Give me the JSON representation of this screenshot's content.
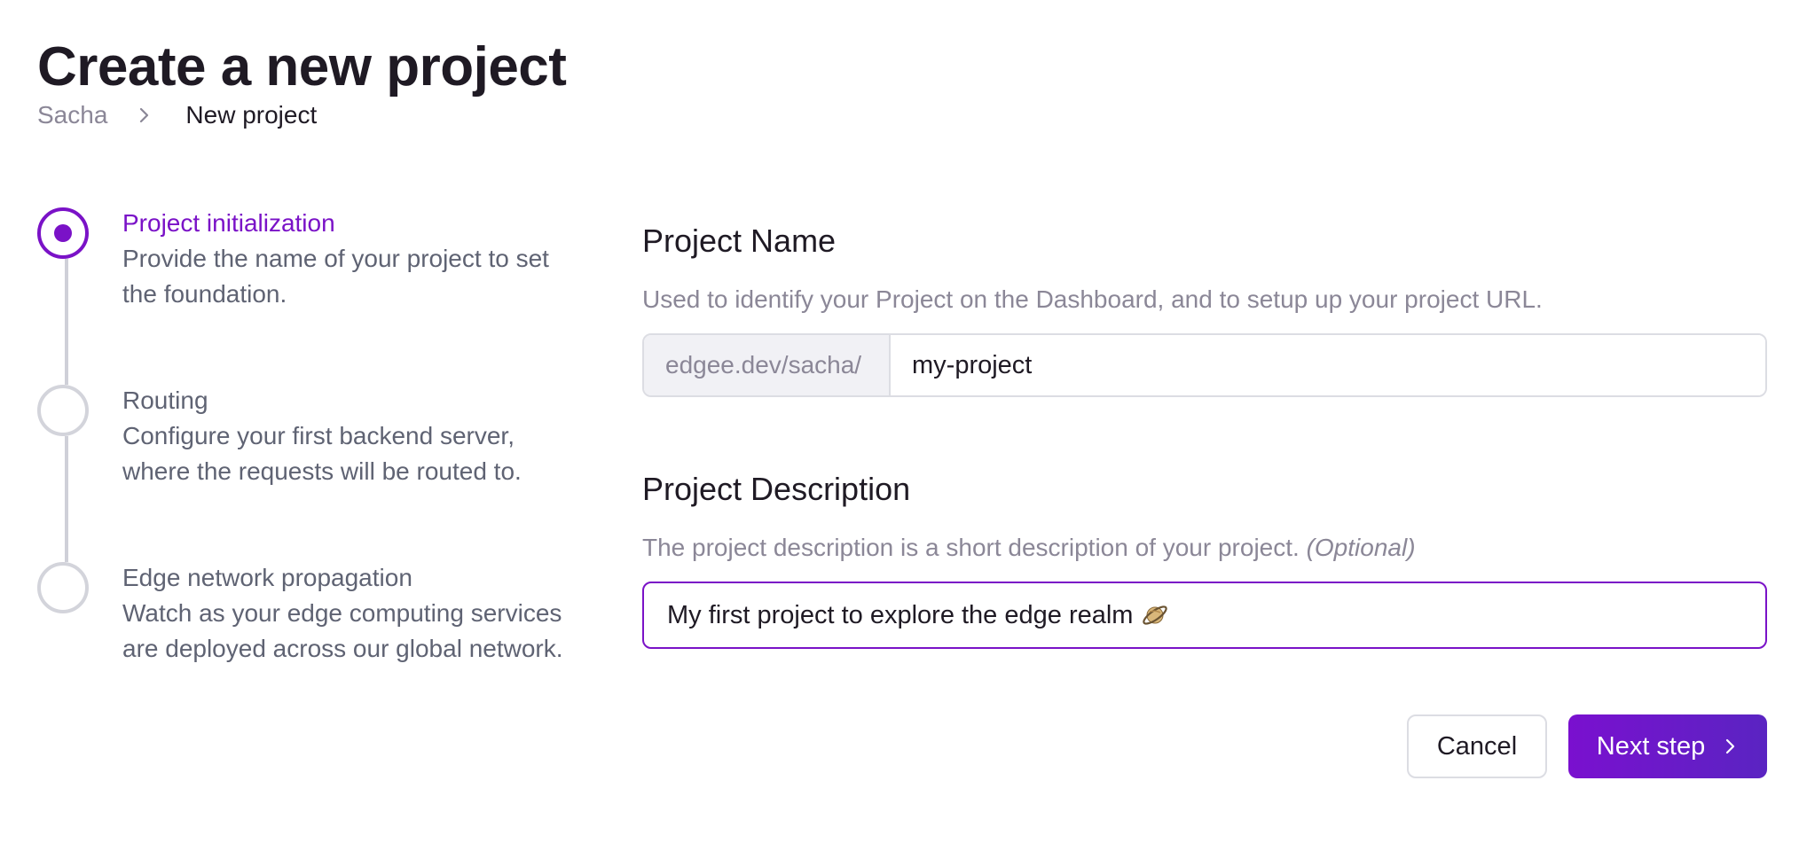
{
  "header": {
    "title": "Create a new project",
    "breadcrumb": {
      "root": "Sacha",
      "current": "New project",
      "separator_icon": "chevron-right-icon"
    }
  },
  "stepper": {
    "steps": [
      {
        "title": "Project initialization",
        "description": "Provide the name of your project to set the foundation.",
        "state": "active"
      },
      {
        "title": "Routing",
        "description": "Configure your first backend server, where the requests will be routed to.",
        "state": "upcoming"
      },
      {
        "title": "Edge network propagation",
        "description": "Watch as your edge computing services are deployed across our global network.",
        "state": "upcoming"
      }
    ]
  },
  "form": {
    "name": {
      "label": "Project Name",
      "help": "Used to identify your Project on the Dashboard, and to setup up your project URL.",
      "prefix": "edgee.dev/sacha/",
      "value": "my-project"
    },
    "description": {
      "label": "Project Description",
      "help": "The project description is a short description of your project.",
      "optional": "(Optional)",
      "value": "My first project to explore the edge realm",
      "emoji_icon": "ringed-planet-icon"
    }
  },
  "actions": {
    "cancel_label": "Cancel",
    "next_label": "Next step",
    "next_icon": "chevron-right-icon"
  },
  "colors": {
    "accent": "#7a12c7",
    "muted_text": "#8b8797",
    "border": "#dcdde3"
  }
}
